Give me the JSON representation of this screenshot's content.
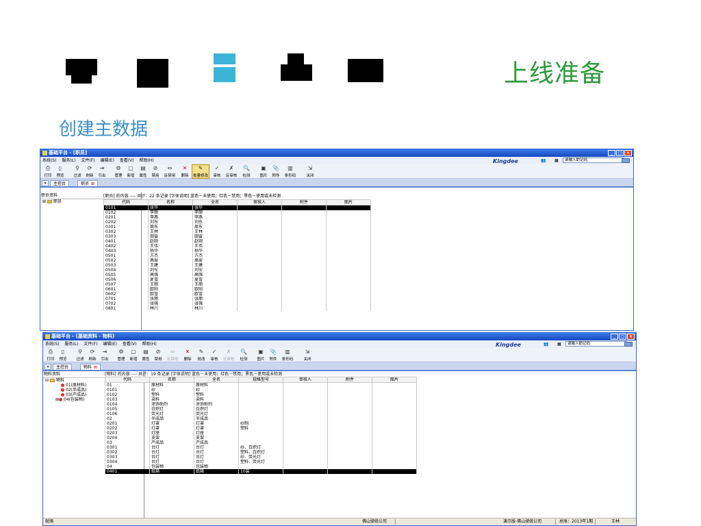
{
  "slide": {
    "title": "上线准备",
    "subtitle": "创建主数据"
  },
  "colors": {
    "title": "#2e9a3c",
    "subtitle": "#3a8fc6",
    "accent_block": "#3cb4d8"
  },
  "window1": {
    "title": "基础平台 - [职员]",
    "menu": [
      "系统(S)",
      "服务(L)",
      "文件(F)",
      "编辑(E)",
      "查看(V)",
      "帮助(H)"
    ],
    "brand": "Kingdee",
    "help_placeholder": "请输入助记码",
    "toolbar": [
      {
        "label": "打印",
        "icon": "printer-icon"
      },
      {
        "label": "预览",
        "icon": "preview-icon"
      },
      {
        "label": "过滤",
        "icon": "filter-icon"
      },
      {
        "label": "刷新",
        "icon": "refresh-icon"
      },
      {
        "label": "引出",
        "icon": "export-icon"
      },
      {
        "label": "管理",
        "icon": "manage-icon"
      },
      {
        "label": "新增",
        "icon": "new-icon"
      },
      {
        "label": "属性",
        "icon": "properties-icon"
      },
      {
        "label": "禁用",
        "icon": "disable-icon"
      },
      {
        "label": "反禁用",
        "icon": "enable-icon"
      },
      {
        "label": "删除",
        "icon": "delete-icon"
      },
      {
        "label": "批量修改",
        "icon": "batch-edit-icon"
      },
      {
        "label": "审核",
        "icon": "approve-icon"
      },
      {
        "label": "反审核",
        "icon": "unapprove-icon"
      },
      {
        "label": "检测",
        "icon": "check-icon"
      },
      {
        "label": "图片",
        "icon": "image-icon"
      },
      {
        "label": "附件",
        "icon": "attachment-icon"
      },
      {
        "label": "条形码",
        "icon": "barcode-icon"
      },
      {
        "label": "关闭",
        "icon": "close-icon"
      }
    ],
    "tabs": [
      {
        "label": "主控台"
      },
      {
        "label": "职员"
      }
    ],
    "tree_header": "职员资料",
    "tree": [
      {
        "label": "职员"
      }
    ],
    "info": "[职员] 的内容 ---- 共计：22 条记录  [字体说明] 蓝色－未使用；红色－禁用；黑色－使用或未检测",
    "columns": [
      "代码",
      "名称",
      "全名",
      "审核人",
      "附件",
      "图片"
    ],
    "rows": [
      [
        "0101",
        "张华",
        "张华"
      ],
      [
        "0102",
        "李丽",
        "李丽"
      ],
      [
        "0201",
        "李燕",
        "李燕"
      ],
      [
        "0202",
        "刘东",
        "刘东"
      ],
      [
        "0301",
        "周东",
        "周东"
      ],
      [
        "0302",
        "王林",
        "王林"
      ],
      [
        "0303",
        "田雷",
        "田雷"
      ],
      [
        "0401",
        "赵刚",
        "赵刚"
      ],
      [
        "0402",
        "王伟",
        "王伟"
      ],
      [
        "0403",
        "杨华",
        "杨华"
      ],
      [
        "0501",
        "方杰",
        "方杰"
      ],
      [
        "0502",
        "高翠",
        "高翠"
      ],
      [
        "0503",
        "王建",
        "王建"
      ],
      [
        "0504",
        "刘军",
        "刘军"
      ],
      [
        "0505",
        "高强",
        "高强"
      ],
      [
        "0506",
        "夏雪",
        "夏雪"
      ],
      [
        "0507",
        "王丽",
        "王丽"
      ],
      [
        "0601",
        "欧阳",
        "欧阳"
      ],
      [
        "0602",
        "欧雪",
        "欧雪"
      ],
      [
        "0701",
        "张丽",
        "张丽"
      ],
      [
        "0702",
        "张强",
        "张强"
      ],
      [
        "0801",
        "林川",
        "林川"
      ]
    ]
  },
  "window2": {
    "title": "基础平台 - [基础资料 - 物料]",
    "menu": [
      "系统(S)",
      "服务(L)",
      "文件(F)",
      "编辑(E)",
      "查看(V)",
      "帮助(H)"
    ],
    "brand": "Kingdee",
    "help_placeholder": "请输入助记码",
    "toolbar": [
      {
        "label": "打印",
        "icon": "printer-icon"
      },
      {
        "label": "预览",
        "icon": "preview-icon"
      },
      {
        "label": "过滤",
        "icon": "filter-icon"
      },
      {
        "label": "刷新",
        "icon": "refresh-icon"
      },
      {
        "label": "引出",
        "icon": "export-icon"
      },
      {
        "label": "管理",
        "icon": "manage-icon"
      },
      {
        "label": "新增",
        "icon": "new-icon"
      },
      {
        "label": "属性",
        "icon": "properties-icon"
      },
      {
        "label": "禁用",
        "icon": "disable-icon"
      },
      {
        "label": "反禁用",
        "icon": "enable-icon"
      },
      {
        "label": "删除",
        "icon": "delete-icon"
      },
      {
        "label": "批改",
        "icon": "batch-edit-icon"
      },
      {
        "label": "审核",
        "icon": "approve-icon"
      },
      {
        "label": "反审核",
        "icon": "unapprove-icon"
      },
      {
        "label": "检测",
        "icon": "check-icon"
      },
      {
        "label": "图片",
        "icon": "image-icon"
      },
      {
        "label": "附件",
        "icon": "attachment-icon"
      },
      {
        "label": "条形码",
        "icon": "barcode-icon"
      },
      {
        "label": "关闭",
        "icon": "close-icon"
      }
    ],
    "tabs": [
      {
        "label": "主控台"
      },
      {
        "label": "物料"
      }
    ],
    "tree_header": "物料资料",
    "tree": [
      {
        "label": "物料",
        "level": 0,
        "type": "folder"
      },
      {
        "label": "01(原材料)",
        "level": 1,
        "type": "dot"
      },
      {
        "label": "02(半成品)",
        "level": 1,
        "type": "dot"
      },
      {
        "label": "03(产成品)",
        "level": 1,
        "type": "dot"
      },
      {
        "label": "04(包装物)",
        "level": 1,
        "type": "dot"
      }
    ],
    "info": "[物料] 的内容 ---- 共计：19 条记录  [字体说明] 蓝色－未使用；红色－禁用；黑色－使用或未检测",
    "columns": [
      "代码",
      "名称",
      "全名",
      "规格型号",
      "审核人",
      "附件",
      "图片"
    ],
    "rows": [
      [
        "01",
        "原材料",
        "原材料",
        ""
      ],
      [
        "0101",
        "纱",
        "纱",
        ""
      ],
      [
        "0102",
        "塑料",
        "塑料",
        ""
      ],
      [
        "0103",
        "染料",
        "染料",
        ""
      ],
      [
        "0104",
        "涂饰助剂",
        "涂饰助剂",
        ""
      ],
      [
        "0105",
        "白炽灯",
        "白炽灯",
        ""
      ],
      [
        "0106",
        "荧光灯",
        "荧光灯",
        ""
      ],
      [
        "02",
        "半成品",
        "半成品",
        ""
      ],
      [
        "0201",
        "灯罩",
        "灯罩",
        "纱制"
      ],
      [
        "0202",
        "灯罩",
        "灯罩",
        "塑料"
      ],
      [
        "0203",
        "灯座",
        "灯座",
        ""
      ],
      [
        "0204",
        "支架",
        "支架",
        ""
      ],
      [
        "03",
        "产成品",
        "产成品",
        ""
      ],
      [
        "0301",
        "台灯",
        "台灯",
        "纱、白炽灯"
      ],
      [
        "0302",
        "台灯",
        "台灯",
        "塑料、白炽灯"
      ],
      [
        "0303",
        "台灯",
        "台灯",
        "纱、荧光灯"
      ],
      [
        "0304",
        "台灯",
        "台灯",
        "塑料、荧光灯"
      ],
      [
        "04",
        "包装物",
        "包装物",
        ""
      ],
      [
        "0401",
        "纸箱",
        "纸箱",
        "10装"
      ]
    ],
    "status": {
      "left": "就绪",
      "company": "佛山驶统公司",
      "account": "演示版-佛山驶统公司",
      "period": "总账：2013年1期",
      "user": "王林"
    }
  }
}
